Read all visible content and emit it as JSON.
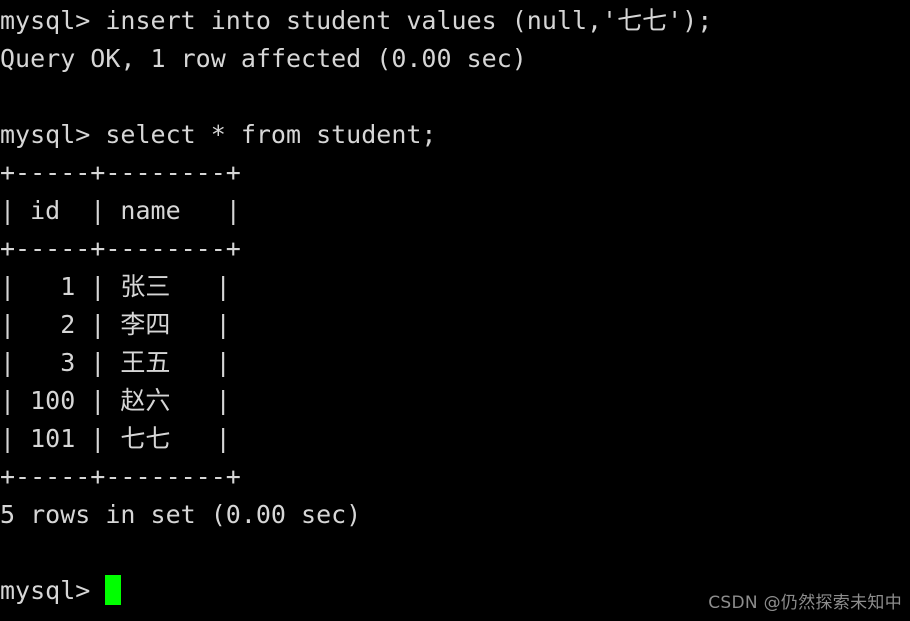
{
  "terminal": {
    "background_color": "#000000",
    "text_color": "#d6d6d6",
    "cursor_color": "#00ff00",
    "lines": [
      {
        "id": "insert-command",
        "text": "mysql> insert into student values (null,'七七');"
      },
      {
        "id": "insert-result",
        "text": "Query OK, 1 row affected (0.00 sec)"
      },
      {
        "id": "blank-1",
        "text": ""
      },
      {
        "id": "select-command",
        "text": "mysql> select * from student;"
      },
      {
        "id": "table-top-border",
        "text": "+-----+--------+"
      },
      {
        "id": "table-header-row",
        "text": "| id  | name   |"
      },
      {
        "id": "table-head-border",
        "text": "+-----+--------+"
      },
      {
        "id": "table-row-1",
        "text": "|   1 | 张三   |"
      },
      {
        "id": "table-row-2",
        "text": "|   2 | 李四   |"
      },
      {
        "id": "table-row-3",
        "text": "|   3 | 王五   |"
      },
      {
        "id": "table-row-4",
        "text": "| 100 | 赵六   |"
      },
      {
        "id": "table-row-5",
        "text": "| 101 | 七七   |"
      },
      {
        "id": "table-bot-border",
        "text": "+-----+--------+"
      },
      {
        "id": "select-result",
        "text": "5 rows in set (0.00 sec)"
      },
      {
        "id": "blank-2",
        "text": ""
      }
    ],
    "final_prompt": "mysql> "
  },
  "query_result": {
    "type": "table",
    "columns": [
      "id",
      "name"
    ],
    "rows": [
      {
        "id": "1",
        "name": "张三"
      },
      {
        "id": "2",
        "name": "李四"
      },
      {
        "id": "3",
        "name": "王五"
      },
      {
        "id": "100",
        "name": "赵六"
      },
      {
        "id": "101",
        "name": "七七"
      }
    ],
    "row_count_text": "5 rows in set (0.00 sec)"
  },
  "watermark": {
    "text": "CSDN @仍然探索未知中"
  }
}
